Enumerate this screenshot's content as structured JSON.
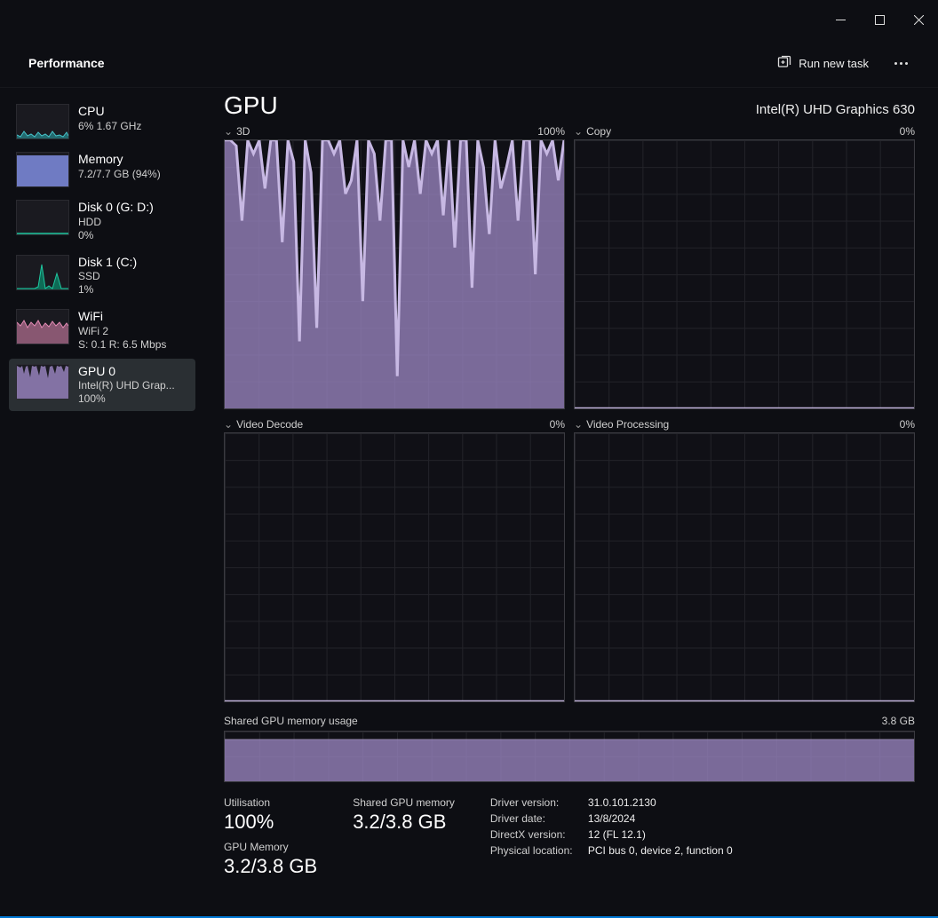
{
  "window": {
    "header_title": "Performance",
    "run_new_task": "Run new task"
  },
  "sidebar": {
    "items": [
      {
        "name": "CPU",
        "sub": "6%  1.67 GHz",
        "sub2": ""
      },
      {
        "name": "Memory",
        "sub": "7.2/7.7 GB (94%)",
        "sub2": ""
      },
      {
        "name": "Disk 0 (G: D:)",
        "sub": "HDD",
        "sub2": "0%"
      },
      {
        "name": "Disk 1 (C:)",
        "sub": "SSD",
        "sub2": "1%"
      },
      {
        "name": "WiFi",
        "sub": "WiFi 2",
        "sub2": "S: 0.1 R: 6.5 Mbps"
      },
      {
        "name": "GPU 0",
        "sub": "Intel(R) UHD Grap...",
        "sub2": "100%"
      }
    ]
  },
  "main": {
    "title": "GPU",
    "device": "Intel(R) UHD Graphics 630",
    "charts": [
      {
        "label": "3D",
        "max": "100%"
      },
      {
        "label": "Copy",
        "max": "0%"
      },
      {
        "label": "Video Decode",
        "max": "0%"
      },
      {
        "label": "Video Processing",
        "max": "0%"
      }
    ],
    "shared_mem": {
      "label": "Shared GPU memory usage",
      "max": "3.8 GB"
    },
    "stats": {
      "util_label": "Utilisation",
      "util_value": "100%",
      "gpumem_label": "GPU Memory",
      "gpumem_value": "3.2/3.8 GB",
      "shared_label": "Shared GPU memory",
      "shared_value": "3.2/3.8 GB"
    },
    "details": {
      "driver_version_k": "Driver version:",
      "driver_version_v": "31.0.101.2130",
      "driver_date_k": "Driver date:",
      "driver_date_v": "13/8/2024",
      "directx_k": "DirectX version:",
      "directx_v": "12 (FL 12.1)",
      "location_k": "Physical location:",
      "location_v": "PCI bus 0, device 2, function 0"
    }
  },
  "chart_data": [
    {
      "type": "area",
      "title": "3D",
      "ylabel": "%",
      "ylim": [
        0,
        100
      ],
      "values": [
        100,
        100,
        98,
        70,
        100,
        95,
        100,
        82,
        100,
        100,
        62,
        100,
        92,
        25,
        100,
        88,
        30,
        100,
        100,
        95,
        100,
        80,
        85,
        100,
        40,
        100,
        95,
        70,
        100,
        100,
        12,
        100,
        90,
        100,
        80,
        100,
        95,
        100,
        72,
        100,
        60,
        100,
        100,
        45,
        100,
        90,
        65,
        100,
        82,
        90,
        100,
        70,
        100,
        100,
        50,
        100,
        95,
        100,
        85,
        100
      ]
    },
    {
      "type": "area",
      "title": "Copy",
      "ylabel": "%",
      "ylim": [
        0,
        100
      ],
      "values": [
        0,
        0,
        0,
        0,
        0,
        0,
        0,
        0,
        0,
        0,
        0,
        0,
        0,
        0,
        0,
        0,
        0,
        0,
        0,
        0,
        0,
        0,
        0,
        0,
        0,
        0,
        0,
        0,
        0,
        0,
        0,
        0,
        0,
        0,
        0,
        0,
        0,
        0,
        0,
        0,
        0,
        0,
        0,
        0,
        0,
        0,
        0,
        0,
        0,
        0,
        0,
        0,
        0,
        0,
        0,
        0,
        0,
        0,
        0,
        0
      ]
    },
    {
      "type": "area",
      "title": "Video Decode",
      "ylabel": "%",
      "ylim": [
        0,
        100
      ],
      "values": [
        0,
        0,
        0,
        0,
        0,
        0,
        0,
        0,
        0,
        0,
        0,
        0,
        0,
        0,
        0,
        0,
        0,
        0,
        0,
        0,
        0,
        0,
        0,
        0,
        0,
        0,
        0,
        0,
        0,
        0,
        0,
        0,
        0,
        0,
        0,
        0,
        0,
        0,
        0,
        0,
        0,
        0,
        0,
        0,
        0,
        0,
        0,
        0,
        0,
        0,
        0,
        0,
        0,
        0,
        0,
        0,
        0,
        0,
        0,
        0
      ]
    },
    {
      "type": "area",
      "title": "Video Processing",
      "ylabel": "%",
      "ylim": [
        0,
        100
      ],
      "values": [
        0,
        0,
        0,
        0,
        0,
        0,
        0,
        0,
        0,
        0,
        0,
        0,
        0,
        0,
        0,
        0,
        0,
        0,
        0,
        0,
        0,
        0,
        0,
        0,
        0,
        0,
        0,
        0,
        0,
        0,
        0,
        0,
        0,
        0,
        0,
        0,
        0,
        0,
        0,
        0,
        0,
        0,
        0,
        0,
        0,
        0,
        0,
        0,
        0,
        0,
        0,
        0,
        0,
        0,
        0,
        0,
        0,
        0,
        0,
        0
      ]
    },
    {
      "type": "area",
      "title": "Shared GPU memory usage",
      "ylabel": "GB",
      "ylim": [
        0,
        3.8
      ],
      "values": [
        3.2,
        3.2,
        3.2,
        3.2,
        3.2,
        3.2,
        3.2,
        3.2,
        3.2,
        3.2,
        3.2,
        3.2,
        3.2,
        3.2,
        3.2,
        3.2,
        3.2,
        3.2,
        3.2,
        3.2,
        3.2,
        3.2,
        3.2,
        3.2,
        3.2,
        3.2,
        3.2,
        3.2,
        3.2,
        3.2,
        3.2,
        3.2,
        3.2,
        3.2,
        3.2,
        3.2,
        3.2,
        3.2,
        3.2,
        3.2,
        3.2,
        3.2,
        3.2,
        3.2,
        3.2,
        3.2,
        3.2,
        3.2,
        3.2,
        3.2,
        3.2,
        3.2,
        3.2,
        3.2,
        3.2,
        3.2,
        3.2,
        3.2,
        3.2,
        3.2
      ]
    }
  ]
}
